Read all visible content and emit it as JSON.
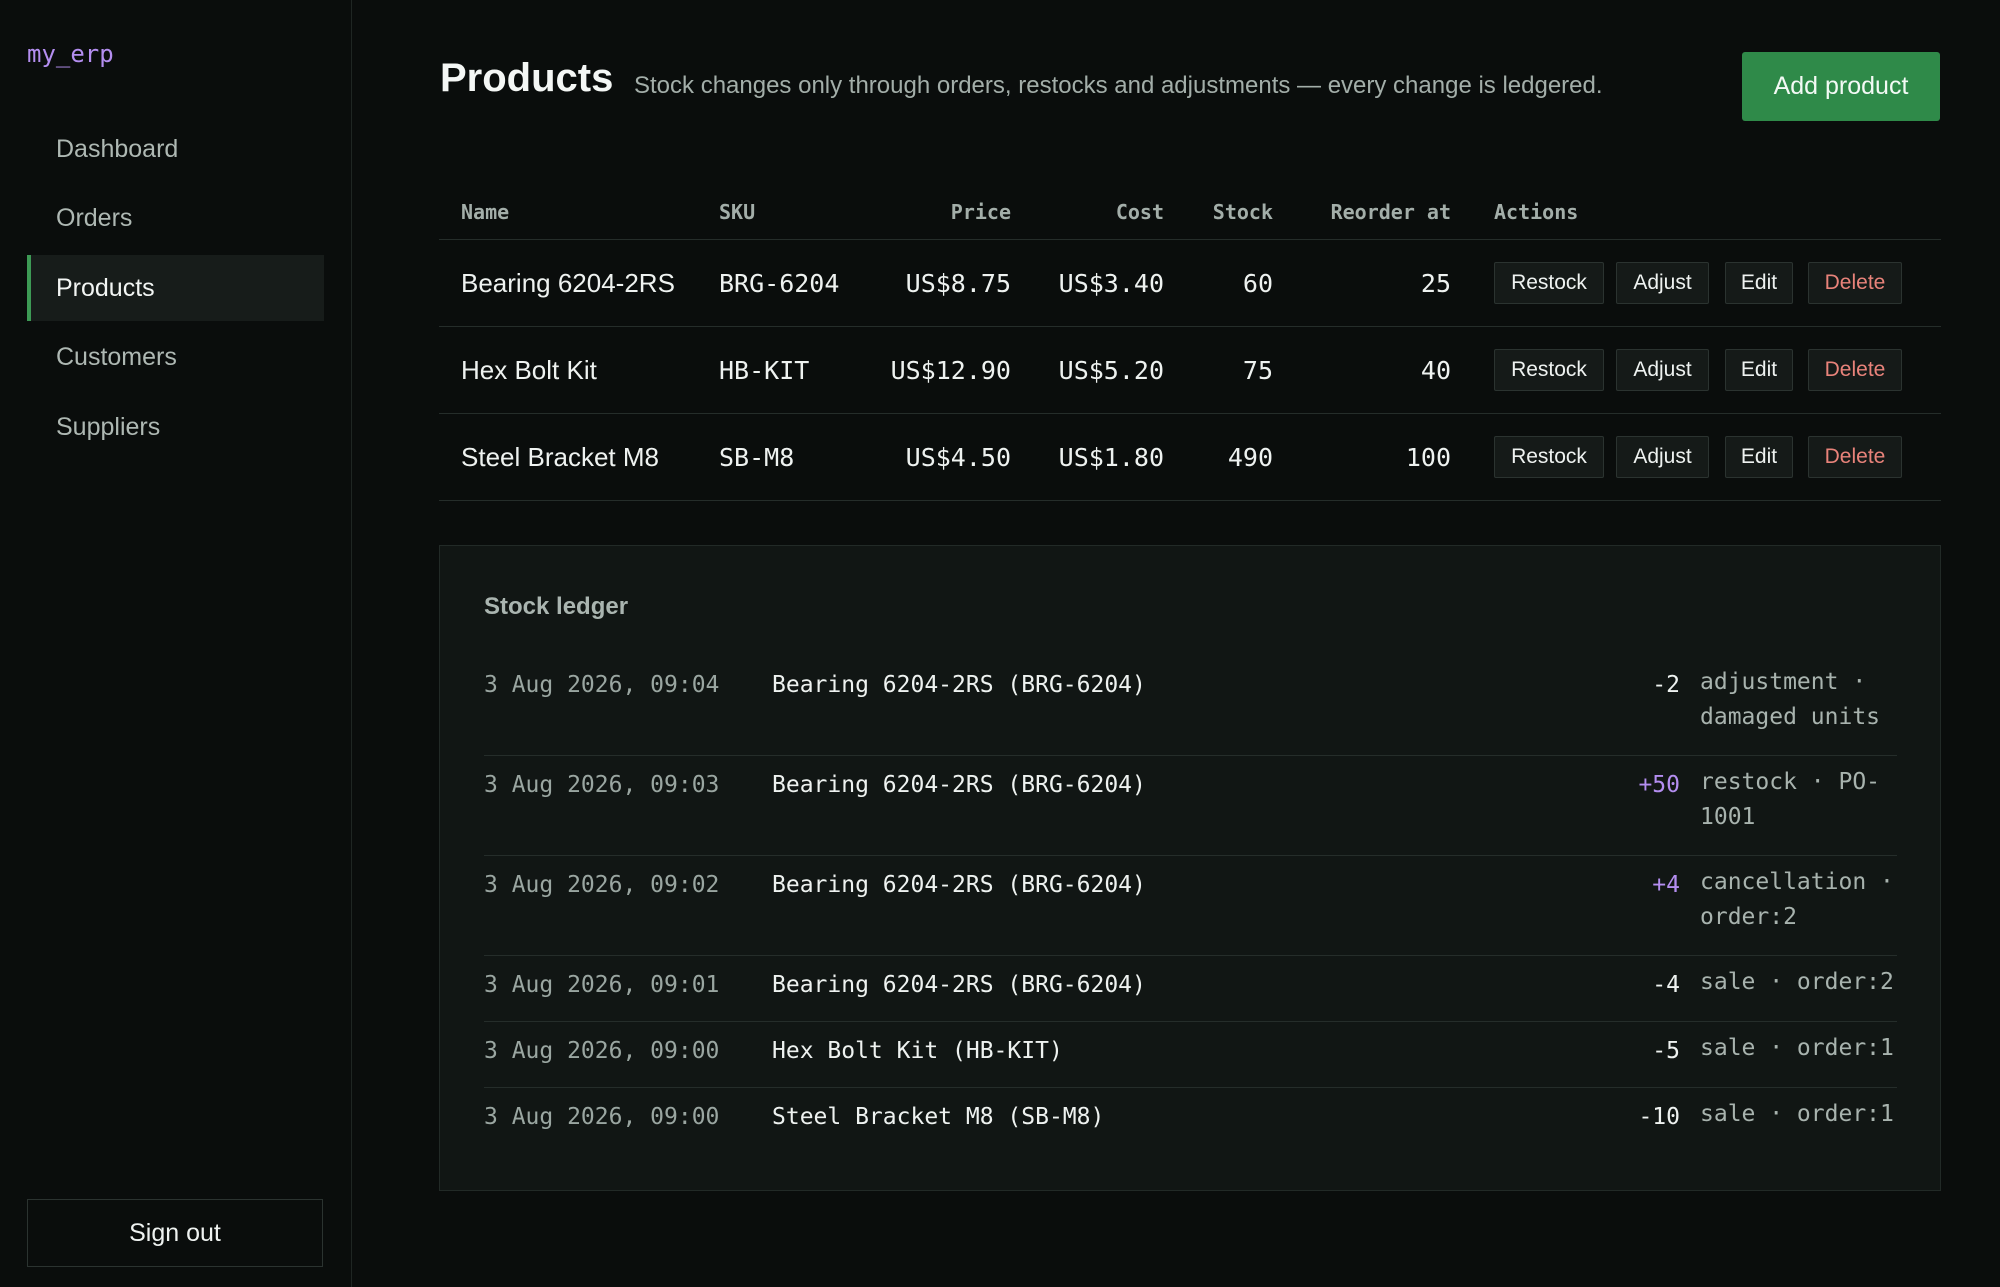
{
  "app": {
    "brand": "my_erp"
  },
  "sidebar": {
    "items": [
      {
        "label": "Dashboard",
        "active": false
      },
      {
        "label": "Orders",
        "active": false
      },
      {
        "label": "Products",
        "active": true
      },
      {
        "label": "Customers",
        "active": false
      },
      {
        "label": "Suppliers",
        "active": false
      }
    ],
    "sign_out": "Sign out"
  },
  "header": {
    "title": "Products",
    "subtitle": "Stock changes only through orders, restocks and adjustments — every change is ledgered.",
    "add_button": "Add product"
  },
  "products": {
    "columns": [
      "Name",
      "SKU",
      "Price",
      "Cost",
      "Stock",
      "Reorder at",
      "Actions"
    ],
    "actions": {
      "restock": "Restock",
      "adjust": "Adjust",
      "edit": "Edit",
      "delete": "Delete"
    },
    "rows": [
      {
        "name": "Bearing 6204-2RS",
        "sku": "BRG-6204",
        "price": "US$8.75",
        "cost": "US$3.40",
        "stock": "60",
        "reorder": "25"
      },
      {
        "name": "Hex Bolt Kit",
        "sku": "HB-KIT",
        "price": "US$12.90",
        "cost": "US$5.20",
        "stock": "75",
        "reorder": "40"
      },
      {
        "name": "Steel Bracket M8",
        "sku": "SB-M8",
        "price": "US$4.50",
        "cost": "US$1.80",
        "stock": "490",
        "reorder": "100"
      }
    ]
  },
  "ledger": {
    "title": "Stock ledger",
    "entries": [
      {
        "time": "3 Aug 2026, 09:04",
        "product": "Bearing 6204-2RS (BRG-6204)",
        "qty": "-2",
        "note_line1": "adjustment ·",
        "note_line2": "damaged units"
      },
      {
        "time": "3 Aug 2026, 09:03",
        "product": "Bearing 6204-2RS (BRG-6204)",
        "qty": "+50",
        "note_line1": "restock · PO-",
        "note_line2": "1001"
      },
      {
        "time": "3 Aug 2026, 09:02",
        "product": "Bearing 6204-2RS (BRG-6204)",
        "qty": "+4",
        "note_line1": "cancellation ·",
        "note_line2": "order:2"
      },
      {
        "time": "3 Aug 2026, 09:01",
        "product": "Bearing 6204-2RS (BRG-6204)",
        "qty": "-4",
        "note_line1": "sale · order:2",
        "note_line2": ""
      },
      {
        "time": "3 Aug 2026, 09:00",
        "product": "Hex Bolt Kit (HB-KIT)",
        "qty": "-5",
        "note_line1": "sale · order:1",
        "note_line2": ""
      },
      {
        "time": "3 Aug 2026, 09:00",
        "product": "Steel Bracket M8 (SB-M8)",
        "qty": "-10",
        "note_line1": "sale · order:1",
        "note_line2": ""
      }
    ]
  },
  "colors": {
    "accent_green": "#2f8a49",
    "brand_purple": "#b48ef0",
    "delete_red": "#e8837a",
    "background": "#0a0d0c"
  }
}
